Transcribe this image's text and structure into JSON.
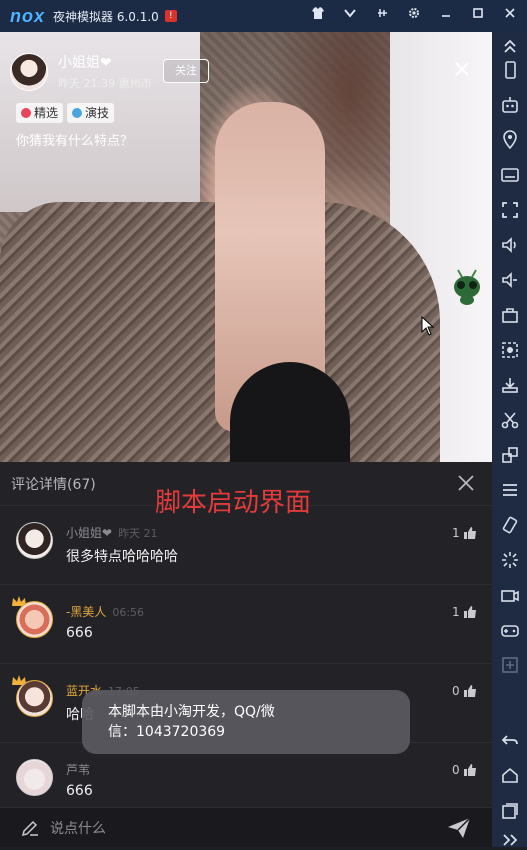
{
  "emulator": {
    "logo": "nox",
    "title": "夜神模拟器 6.0.1.0",
    "alert": "!",
    "controls": [
      "shirt-icon",
      "chevron-down-icon",
      "pin-icon",
      "gear-icon",
      "minimize-icon",
      "maximize-icon",
      "close-icon"
    ]
  },
  "video": {
    "author_name": "小姐姐❤",
    "author_meta": "昨天 21:39 惠州市",
    "follow_label": "关注",
    "tags": [
      "精选",
      "演技"
    ],
    "caption": "你猜我有什么特点？"
  },
  "overlay": {
    "title": "脚本启动界面"
  },
  "comments": {
    "header": "评论详情(67)",
    "items": [
      {
        "name": "小姐姐❤",
        "time": "昨天 21",
        "text": "很多特点哈哈哈哈",
        "likes": "1"
      },
      {
        "name": "-黑美人",
        "time": "06:56",
        "text": "666",
        "likes": "1"
      },
      {
        "name": "蓝开水",
        "time": "17:05",
        "text": "哈哈",
        "likes": "0"
      },
      {
        "name": "芦苇",
        "time": "",
        "text": "666",
        "likes": "0"
      }
    ]
  },
  "toast": {
    "line1": "本脚本由小淘开发，QQ/微",
    "line2": "信：1043720369"
  },
  "input": {
    "placeholder": "说点什么"
  },
  "colors": {
    "titlebar": "#1b2a45",
    "sidebar": "#1e2b42",
    "overlay_red": "#e23b3b",
    "gold_name": "#e0a73a"
  }
}
